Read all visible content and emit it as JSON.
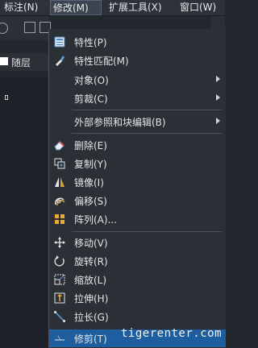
{
  "menubar": {
    "items": [
      {
        "label": "标注(N)"
      },
      {
        "label": "修改(M)"
      },
      {
        "label": "扩展工具(X)"
      },
      {
        "label": "窗口(W)"
      }
    ]
  },
  "toolbar": {
    "layer_name": "随层"
  },
  "menu": {
    "items": [
      {
        "label": "特性(P)",
        "icon": "properties-icon"
      },
      {
        "label": "特性匹配(M)",
        "icon": "match-properties-icon"
      },
      {
        "label": "对象(O)",
        "submenu": true
      },
      {
        "label": "剪裁(C)",
        "submenu": true
      },
      {
        "label": "外部参照和块编辑(B)",
        "submenu": true
      },
      {
        "label": "删除(E)",
        "icon": "erase-icon"
      },
      {
        "label": "复制(Y)",
        "icon": "copy-icon"
      },
      {
        "label": "镜像(I)",
        "icon": "mirror-icon"
      },
      {
        "label": "偏移(S)",
        "icon": "offset-icon"
      },
      {
        "label": "阵列(A)...",
        "icon": "array-icon"
      },
      {
        "label": "移动(V)",
        "icon": "move-icon"
      },
      {
        "label": "旋转(R)",
        "icon": "rotate-icon"
      },
      {
        "label": "缩放(L)",
        "icon": "scale-icon"
      },
      {
        "label": "拉伸(H)",
        "icon": "stretch-icon"
      },
      {
        "label": "拉长(G)",
        "icon": "lengthen-icon"
      },
      {
        "label": "修剪(T)",
        "icon": "trim-icon"
      }
    ]
  },
  "watermark": "tigerenter.com",
  "colors": {
    "highlight": "#1f5e9e",
    "menu_bg": "#2b2f36",
    "canvas_bg": "#1e2228"
  }
}
